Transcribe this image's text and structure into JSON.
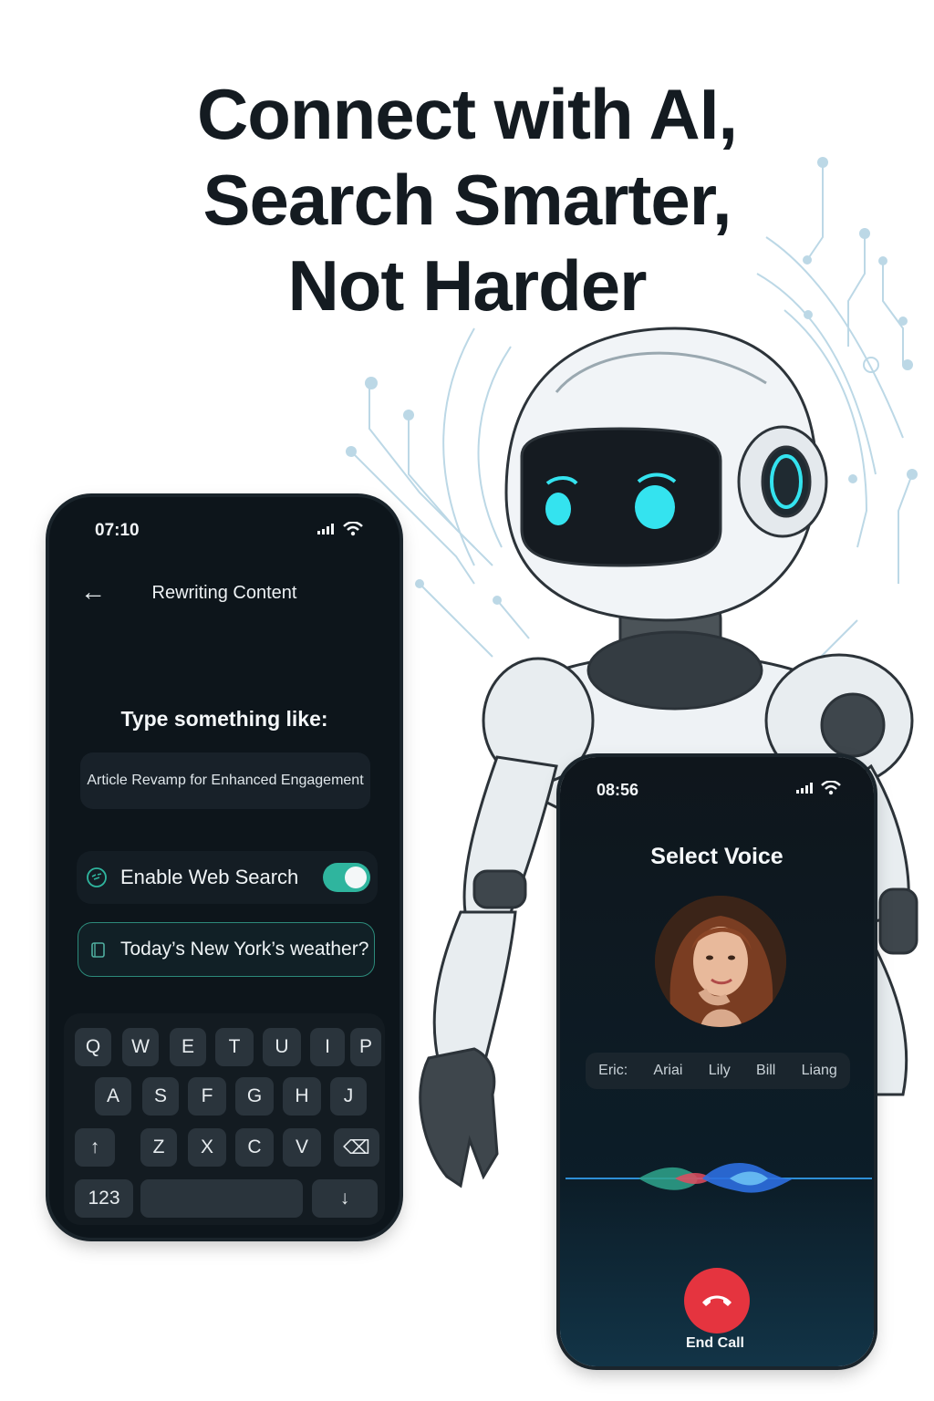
{
  "headline": {
    "line1": "Connect with AI,",
    "line2": "Search Smarter,",
    "line3": "Not Harder"
  },
  "phone_left": {
    "time": "07:10",
    "status_icons": [
      "signal-icon",
      "wifi-icon"
    ],
    "title": "Rewriting Content",
    "hint_label": "Type something like:",
    "suggestion": "Article Revamp for Enhanced Engagement",
    "web_search": {
      "label": "Enable Web Search",
      "enabled": true
    },
    "query": "Today’s New York’s weather?",
    "keyboard": {
      "row1": [
        "Q",
        "W",
        "E",
        "T",
        "U",
        "I",
        "P"
      ],
      "row2": [
        "A",
        "S",
        "F",
        "G",
        "H",
        "J"
      ],
      "row3": [
        "Z",
        "X",
        "C",
        "V"
      ],
      "shift": "↑",
      "backspace": "⌫",
      "numbers": "123",
      "enter": "↓"
    }
  },
  "phone_right": {
    "time": "08:56",
    "title": "Select Voice",
    "voices": [
      "Eric:",
      "Ariai",
      "Lily",
      "Bill",
      "Liang"
    ],
    "end_call": "End Call",
    "colors": {
      "end_call": "#e5343f",
      "accent": "#2fb59e"
    }
  }
}
